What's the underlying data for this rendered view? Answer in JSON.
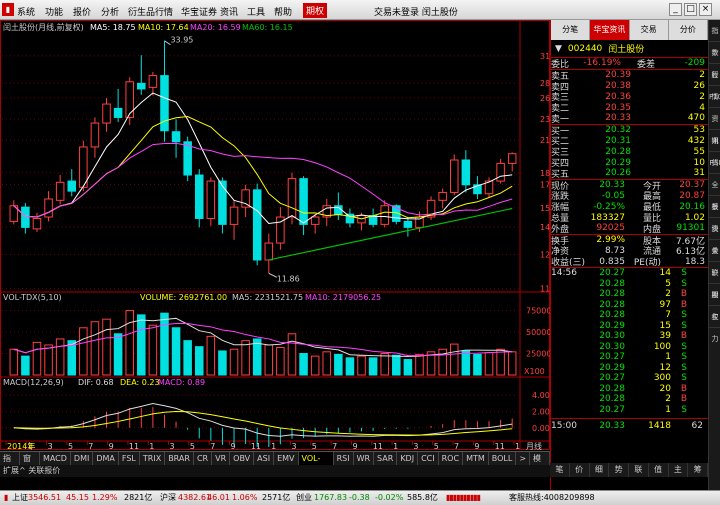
{
  "menu": {
    "items": [
      "系统",
      "功能",
      "报价",
      "分析",
      "衍生品行情",
      "华宝证券",
      "资讯",
      "工具",
      "帮助"
    ],
    "active": "期权",
    "center_title": "交易未登录  闰土股份"
  },
  "chart": {
    "title_text": "闰土股份(月线,前复权)",
    "ma5": "MA5: 18.75",
    "ma10": "MA10: 17.64",
    "ma20": "MA20: 16.59",
    "ma60": "MA60: 16.15",
    "high_label": "33.95",
    "low_label": "11.86",
    "price_axis": [
      "31.71",
      "28.03",
      "26.21",
      "23.82",
      "21.65",
      "18.69",
      "17.72",
      "15.95",
      "14.63",
      "12.92",
      "11.07"
    ],
    "vol_title": "VOL-TDX(5,10)",
    "vol_value": "VOLUME: 2692761.00",
    "vol_ma5": "MA5: 2231521.75",
    "vol_ma10": "MA10: 2179056.25",
    "vol_axis": [
      "75000",
      "50000",
      "25000",
      "X100"
    ],
    "macd_title": "MACD(12,26,9)",
    "dif": "DIF: 0.68",
    "dea": "DEA: 0.23",
    "macd": "MACD: 0.89",
    "macd_axis": [
      "4.00",
      "2.00",
      "0.00"
    ],
    "date_labels": [
      "2014年",
      "1",
      "3",
      "5",
      "7",
      "9",
      "11",
      "1",
      "3",
      "5",
      "7",
      "9",
      "11",
      "1",
      "3",
      "5",
      "7",
      "9",
      "11",
      "1",
      "3",
      "5",
      "7",
      "9",
      "11",
      "1"
    ],
    "period_label": "月线",
    "candles": [
      [
        15,
        16.5,
        14.8,
        16.1
      ],
      [
        16,
        16.3,
        14.2,
        14.6
      ],
      [
        14.5,
        15.6,
        14.3,
        15.2
      ],
      [
        15.3,
        17.2,
        15,
        16.6
      ],
      [
        16.5,
        18.5,
        16.2,
        17.9
      ],
      [
        18,
        19,
        16.8,
        17.2
      ],
      [
        17.5,
        21.6,
        17.2,
        21
      ],
      [
        21,
        24,
        20,
        23.4
      ],
      [
        23.4,
        26.2,
        22.5,
        25.5
      ],
      [
        25,
        27.3,
        23.5,
        24
      ],
      [
        24,
        28.8,
        23.2,
        28.2
      ],
      [
        28,
        31.8,
        26.6,
        27.3
      ],
      [
        27.5,
        29.5,
        26.5,
        29
      ],
      [
        29,
        33.95,
        21.5,
        22.6
      ],
      [
        22.5,
        23.8,
        20,
        21.5
      ],
      [
        21.5,
        22,
        18,
        18.5
      ],
      [
        18.5,
        19,
        14.6,
        15.2
      ],
      [
        15.2,
        18.3,
        14.7,
        18
      ],
      [
        18,
        18.3,
        14.2,
        14.8
      ],
      [
        14.8,
        16.5,
        13.8,
        16
      ],
      [
        16,
        17.7,
        15.3,
        17.3
      ],
      [
        17.3,
        17.8,
        12.3,
        12.6
      ],
      [
        12.6,
        14.2,
        11.86,
        13.6
      ],
      [
        13.6,
        16,
        13.2,
        15.3
      ],
      [
        15.3,
        18.7,
        14.8,
        18.2
      ],
      [
        18.2,
        18.4,
        14.1,
        14.8
      ],
      [
        14.8,
        15.5,
        14.2,
        15.3
      ],
      [
        15.3,
        16.6,
        14.7,
        16.1
      ],
      [
        16.1,
        17.1,
        15.1,
        15.5
      ],
      [
        15.5,
        15.9,
        14.6,
        14.9
      ],
      [
        14.9,
        15.6,
        14.4,
        15.4
      ],
      [
        15.4,
        15.9,
        14.6,
        14.8
      ],
      [
        14.8,
        16.5,
        14.6,
        16.1
      ],
      [
        16.1,
        16.2,
        14.8,
        15
      ],
      [
        15,
        15.3,
        14,
        14.6
      ],
      [
        14.6,
        15.7,
        14.3,
        15.3
      ],
      [
        15.3,
        16.8,
        15.1,
        16.5
      ],
      [
        16.5,
        17.4,
        15.9,
        17.1
      ],
      [
        17.1,
        20.3,
        16.9,
        19.8
      ],
      [
        19.8,
        20.7,
        17.1,
        17.7
      ],
      [
        17.7,
        18.4,
        16.6,
        17
      ],
      [
        17,
        18.3,
        16.7,
        18
      ],
      [
        18,
        19.9,
        17.8,
        19.5
      ],
      [
        19.5,
        20.5,
        18.8,
        20.37
      ]
    ],
    "volumes": [
      30000,
      22000,
      38000,
      35000,
      42000,
      40000,
      55000,
      62000,
      65000,
      48000,
      75000,
      70000,
      58000,
      72000,
      55000,
      40000,
      33000,
      45000,
      28000,
      30000,
      40000,
      42000,
      35000,
      32000,
      48000,
      25000,
      22000,
      27000,
      24000,
      20000,
      22000,
      20000,
      25000,
      23000,
      18000,
      24000,
      27000,
      30000,
      36000,
      28000,
      24000,
      26000,
      30000,
      27000
    ]
  },
  "quote": {
    "tabs": [
      "分笔",
      "华宝资讯",
      "交易",
      "分价"
    ],
    "code": "002440",
    "name": "闰土股份",
    "webi_label": "委比",
    "webi": "-16.19%",
    "weicha_label": "委差",
    "weicha": "-209",
    "asks": [
      {
        "l": "卖五",
        "p": "20.39",
        "v": "2"
      },
      {
        "l": "卖四",
        "p": "20.38",
        "v": "26"
      },
      {
        "l": "卖三",
        "p": "20.36",
        "v": "2"
      },
      {
        "l": "卖二",
        "p": "20.35",
        "v": "4"
      },
      {
        "l": "卖一",
        "p": "20.33",
        "v": "470"
      }
    ],
    "bids": [
      {
        "l": "买一",
        "p": "20.32",
        "v": "53"
      },
      {
        "l": "买二",
        "p": "20.31",
        "v": "432"
      },
      {
        "l": "买三",
        "p": "20.28",
        "v": "55"
      },
      {
        "l": "买四",
        "p": "20.29",
        "v": "10"
      },
      {
        "l": "买五",
        "p": "20.26",
        "v": "31"
      }
    ],
    "stats": [
      {
        "a": "现价",
        "b": "20.33",
        "c": "今开",
        "d": "20.37"
      },
      {
        "a": "涨跌",
        "b": "-0.05",
        "c": "最高",
        "d": "20.87"
      },
      {
        "a": "涨幅",
        "b": "-0.25%",
        "c": "最低",
        "d": "20.16"
      },
      {
        "a": "总量",
        "b": "183327",
        "c": "量比",
        "d": "1.02"
      },
      {
        "a": "外盘",
        "b": "92025",
        "c": "内盘",
        "d": "91301"
      },
      {
        "a": "换手",
        "b": "2.99%",
        "c": "股本",
        "d": "7.67亿"
      },
      {
        "a": "净资",
        "b": "8.73",
        "c": "流通",
        "d": "6.13亿"
      },
      {
        "a": "收益(三)",
        "b": "0.835",
        "c": "PE(动)",
        "d": "18.3"
      }
    ],
    "ticks_time": "14:56",
    "ticks": [
      {
        "p": "20.27",
        "v": "14",
        "f": "S"
      },
      {
        "p": "20.28",
        "v": "5",
        "f": "S"
      },
      {
        "p": "20.28",
        "v": "2",
        "f": "B"
      },
      {
        "p": "20.28",
        "v": "97",
        "f": "B"
      },
      {
        "p": "20.28",
        "v": "7",
        "f": "S"
      },
      {
        "p": "20.29",
        "v": "15",
        "f": "S"
      },
      {
        "p": "20.30",
        "v": "39",
        "f": "B"
      },
      {
        "p": "20.30",
        "v": "100",
        "f": "S"
      },
      {
        "p": "20.27",
        "v": "1",
        "f": "S"
      },
      {
        "p": "20.29",
        "v": "12",
        "f": "S"
      },
      {
        "p": "20.27",
        "v": "300",
        "f": "S"
      },
      {
        "p": "20.28",
        "v": "20",
        "f": "B"
      },
      {
        "p": "20.28",
        "v": "2",
        "f": "B"
      },
      {
        "p": "20.27",
        "v": "1",
        "f": "S"
      }
    ],
    "final_time": "15:00",
    "final_price": "20.33",
    "final_vol": "1418",
    "final_num": "62",
    "bottom_tabs": [
      "笔",
      "价",
      "细",
      "势",
      "联",
      "值",
      "主",
      "筹"
    ]
  },
  "tabs": [
    "指标",
    "窗口",
    "MACD",
    "DMI",
    "DMA",
    "FSL",
    "TRIX",
    "BRAR",
    "CR",
    "VR",
    "OBV",
    "ASI",
    "EMV",
    "VOL-TDX",
    "RSI",
    "WR",
    "SAR",
    "KDJ",
    "CCI",
    "ROC",
    "MTM",
    "BOLL",
    ">",
    "模板"
  ],
  "bottom_row": "扩展^  关联报价",
  "side_tabs": [
    "指数",
    "个股",
    "行情",
    "F10",
    "资讯",
    "期货",
    "RSI",
    "全景",
    "板块",
    "资金",
    "关联",
    "沪股",
    "期权",
    "主力"
  ],
  "status": {
    "sh_label": "上证",
    "sh_val": "3546.51",
    "sh_chg": "45.15",
    "sh_pct": "1.29%",
    "sh_amt": "2821亿",
    "hs_label": "沪深",
    "hs_val": "4382.61",
    "hs_chg": "46.01",
    "hs_pct": "1.06%",
    "hs_amt": "2571亿",
    "cy_label": "创业",
    "cy_val": "1767.83",
    "cy_chg": "-0.38",
    "cy_pct": "-0.02%",
    "cy_amt": "585.8亿",
    "hotline": "客服热线:4008209898"
  },
  "colors": {
    "up": "#ff4040",
    "down": "#00e0e0",
    "ma5": "#ffffff",
    "ma10": "#ffff00",
    "ma20": "#ff40ff",
    "ma60": "#00c000"
  }
}
